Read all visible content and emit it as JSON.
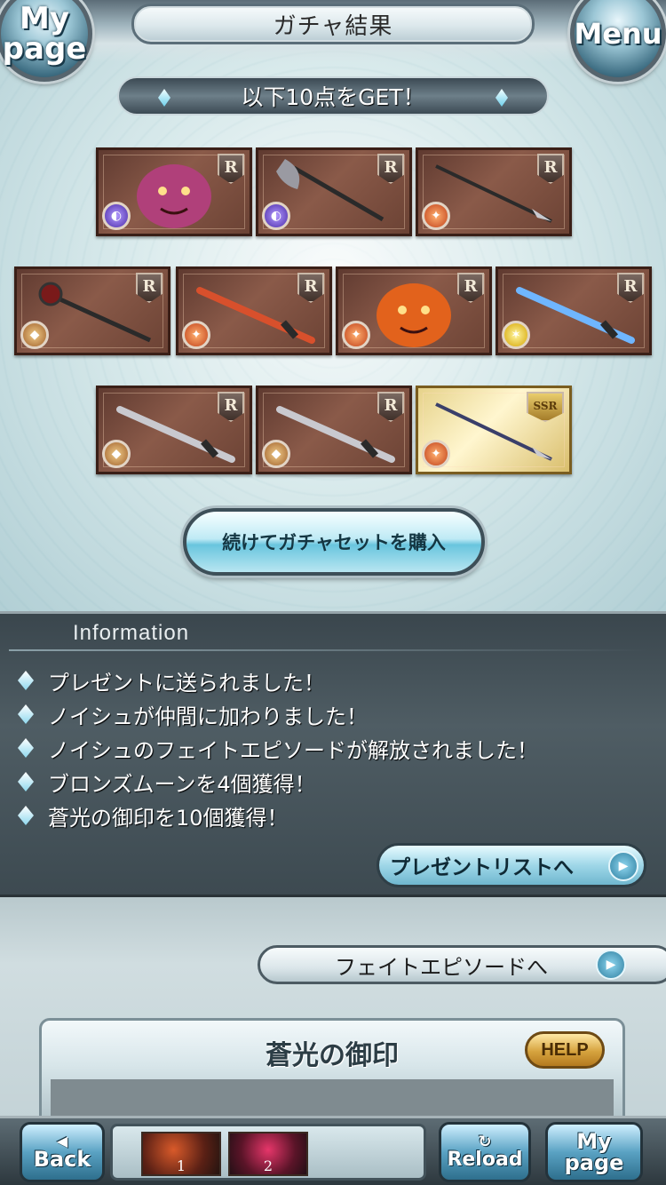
{
  "header": {
    "title": "ガチャ結果",
    "mypage_top": "My",
    "mypage_bottom": "page",
    "menu_label": "Menu"
  },
  "get_banner": "以下10点をGET！",
  "cards": [
    {
      "rarity": "R",
      "element": "dark",
      "kind": "character"
    },
    {
      "rarity": "R",
      "element": "dark",
      "kind": "axe"
    },
    {
      "rarity": "R",
      "element": "fire",
      "kind": "spear"
    },
    {
      "rarity": "R",
      "element": "earth",
      "kind": "mace"
    },
    {
      "rarity": "R",
      "element": "fire",
      "kind": "dagger"
    },
    {
      "rarity": "R",
      "element": "fire",
      "kind": "character"
    },
    {
      "rarity": "R",
      "element": "light",
      "kind": "sword"
    },
    {
      "rarity": "R",
      "element": "earth",
      "kind": "sword"
    },
    {
      "rarity": "R",
      "element": "earth",
      "kind": "sword"
    },
    {
      "rarity": "SSR",
      "element": "fire",
      "kind": "spear"
    }
  ],
  "continue_button": "続けてガチャセットを購入",
  "information": {
    "title": "Information",
    "items": [
      "プレゼントに送られました！",
      "ノイシュが仲間に加わりました！",
      "ノイシュのフェイトエピソードが解放されました！",
      "ブロンズムーンを4個獲得！",
      "蒼光の御印を10個獲得！"
    ],
    "present_button": "プレゼントリストへ"
  },
  "fate_button": "フェイトエピソードへ",
  "seal_panel": {
    "title": "蒼光の御印",
    "help": "HELP"
  },
  "bottom_bar": {
    "back_arrow": "◀",
    "back": "Back",
    "tray_items": [
      "1",
      "2"
    ],
    "reload_icon": "↻",
    "reload": "Reload",
    "mypage_top": "My",
    "mypage_bottom": "page"
  },
  "colors": {
    "card_frame": "#8a5a49",
    "ssr_frame": "#e6d28a",
    "info_bg": "#4f5d64",
    "accent_blue": "#69c5de"
  }
}
